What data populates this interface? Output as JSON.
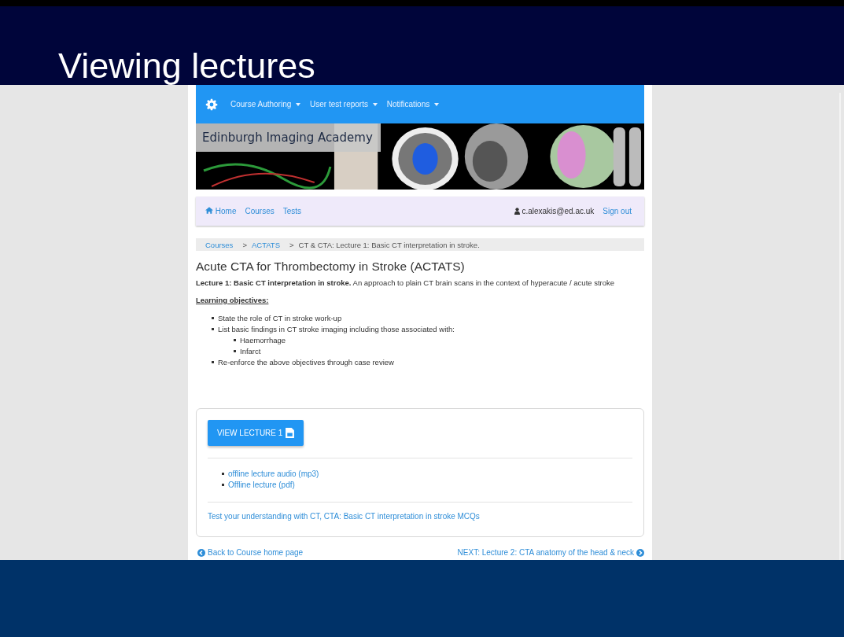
{
  "slide": {
    "title": "Viewing lectures"
  },
  "navbar": {
    "menus": [
      {
        "label": "Course Authoring"
      },
      {
        "label": "User test reports"
      },
      {
        "label": "Notifications"
      }
    ]
  },
  "banner": {
    "title": "Edinburgh Imaging Academy"
  },
  "subnav": {
    "links": [
      {
        "label": "Home",
        "kind": "home"
      },
      {
        "label": "Courses",
        "kind": "plain"
      },
      {
        "label": "Tests",
        "kind": "plain"
      }
    ],
    "user": "c.alexakis@ed.ac.uk",
    "sign_out": "Sign out"
  },
  "breadcrumb": {
    "separator": ">",
    "items": [
      {
        "label": "Courses",
        "kind": "link"
      },
      {
        "label": "ACTATS",
        "kind": "link"
      },
      {
        "label": "CT & CTA: Lecture 1: Basic CT interpretation in stroke.",
        "kind": "current"
      }
    ]
  },
  "heading": "Acute CTA for Thrombectomy in Stroke (ACTATS)",
  "intro": "**Lecture 1: Basic CT interpretation in stroke.** An approach to plain CT brain scans in the context of hyperacute / acute stroke",
  "objectives_heading": "Learning objectives:",
  "objectives": [
    {
      "text": "State the role of CT in stroke work-up"
    },
    {
      "text": "List basic findings in CT stroke imaging including those associated with:",
      "children": [
        {
          "text": "Haemorrhage"
        },
        {
          "text": "Infarct"
        }
      ]
    },
    {
      "text": "Re-enforce the above objectives through case review"
    }
  ],
  "lecture_card": {
    "button": "VIEW LECTURE 1",
    "downloads": [
      {
        "label": "offline lecture audio (mp3)"
      },
      {
        "label": "Offline lecture (pdf)"
      }
    ],
    "test_link": "Test your understanding with CT, CTA: Basic CT interpretation in stroke MCQs"
  },
  "footer_links": {
    "back": "Back to Course home page",
    "next": "NEXT: Lecture 2: CTA anatomy of the head & neck"
  }
}
